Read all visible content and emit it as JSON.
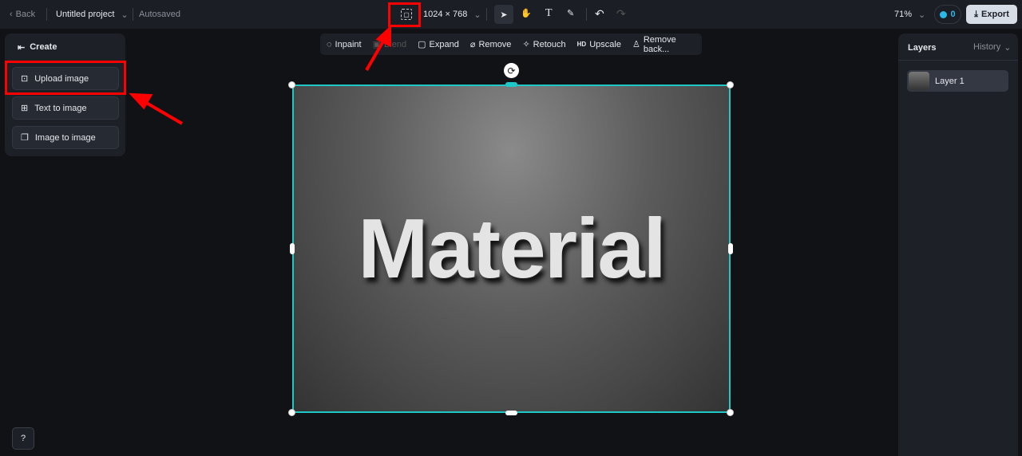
{
  "topbar": {
    "back": "Back",
    "project": "Untitled project",
    "status": "Autosaved",
    "canvas_size": "1024 × 768",
    "zoom": "71%",
    "credits": "0",
    "export": "Export"
  },
  "create_panel": {
    "title": "Create",
    "items": [
      {
        "label": "Upload image",
        "icon": "upload-image-icon"
      },
      {
        "label": "Text to image",
        "icon": "text-to-image-icon"
      },
      {
        "label": "Image to image",
        "icon": "image-to-image-icon"
      }
    ]
  },
  "edit_toolbar": {
    "items": [
      {
        "label": "Inpaint",
        "disabled": false
      },
      {
        "label": "Blend",
        "disabled": true
      },
      {
        "label": "Expand",
        "disabled": false
      },
      {
        "label": "Remove",
        "disabled": false
      },
      {
        "label": "Retouch",
        "disabled": false
      },
      {
        "label": "Upscale",
        "prefix": "HD",
        "disabled": false
      },
      {
        "label": "Remove back...",
        "disabled": false
      }
    ]
  },
  "canvas": {
    "image_text": "Material",
    "selection_color": "#1fc7c7"
  },
  "layers_panel": {
    "title": "Layers",
    "history": "History",
    "layers": [
      {
        "name": "Layer 1"
      }
    ]
  },
  "colors": {
    "annotation": "#ff0000",
    "accent": "#1fc7c7"
  }
}
